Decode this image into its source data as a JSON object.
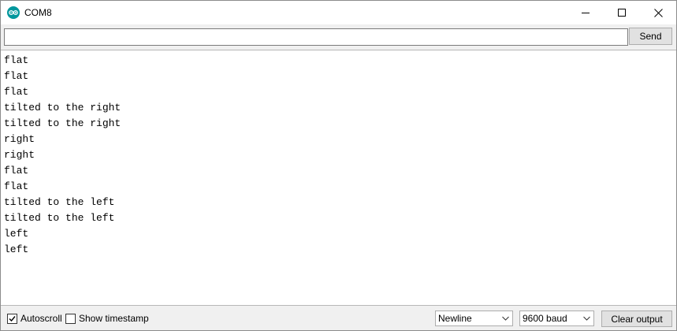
{
  "window": {
    "title": "COM8"
  },
  "send": {
    "input_value": "",
    "button_label": "Send"
  },
  "output": {
    "lines": [
      "flat",
      "flat",
      "flat",
      "tilted to the right",
      "tilted to the right",
      "right",
      "right",
      "flat",
      "flat",
      "tilted to the left",
      "tilted to the left",
      "left",
      "left"
    ]
  },
  "bottombar": {
    "autoscroll_label": "Autoscroll",
    "autoscroll_checked": true,
    "timestamp_label": "Show timestamp",
    "timestamp_checked": false,
    "line_ending": "Newline",
    "baud_rate": "9600 baud",
    "clear_label": "Clear output"
  },
  "colors": {
    "app_icon": "#00979d",
    "window_bg": "#f0f0f0",
    "output_bg": "#ffffff"
  },
  "icons": {
    "app": "arduino-icon",
    "minimize": "minimize-icon",
    "maximize": "maximize-icon",
    "close": "close-icon",
    "dropdown": "chevron-down-icon",
    "check": "checkmark-icon"
  }
}
